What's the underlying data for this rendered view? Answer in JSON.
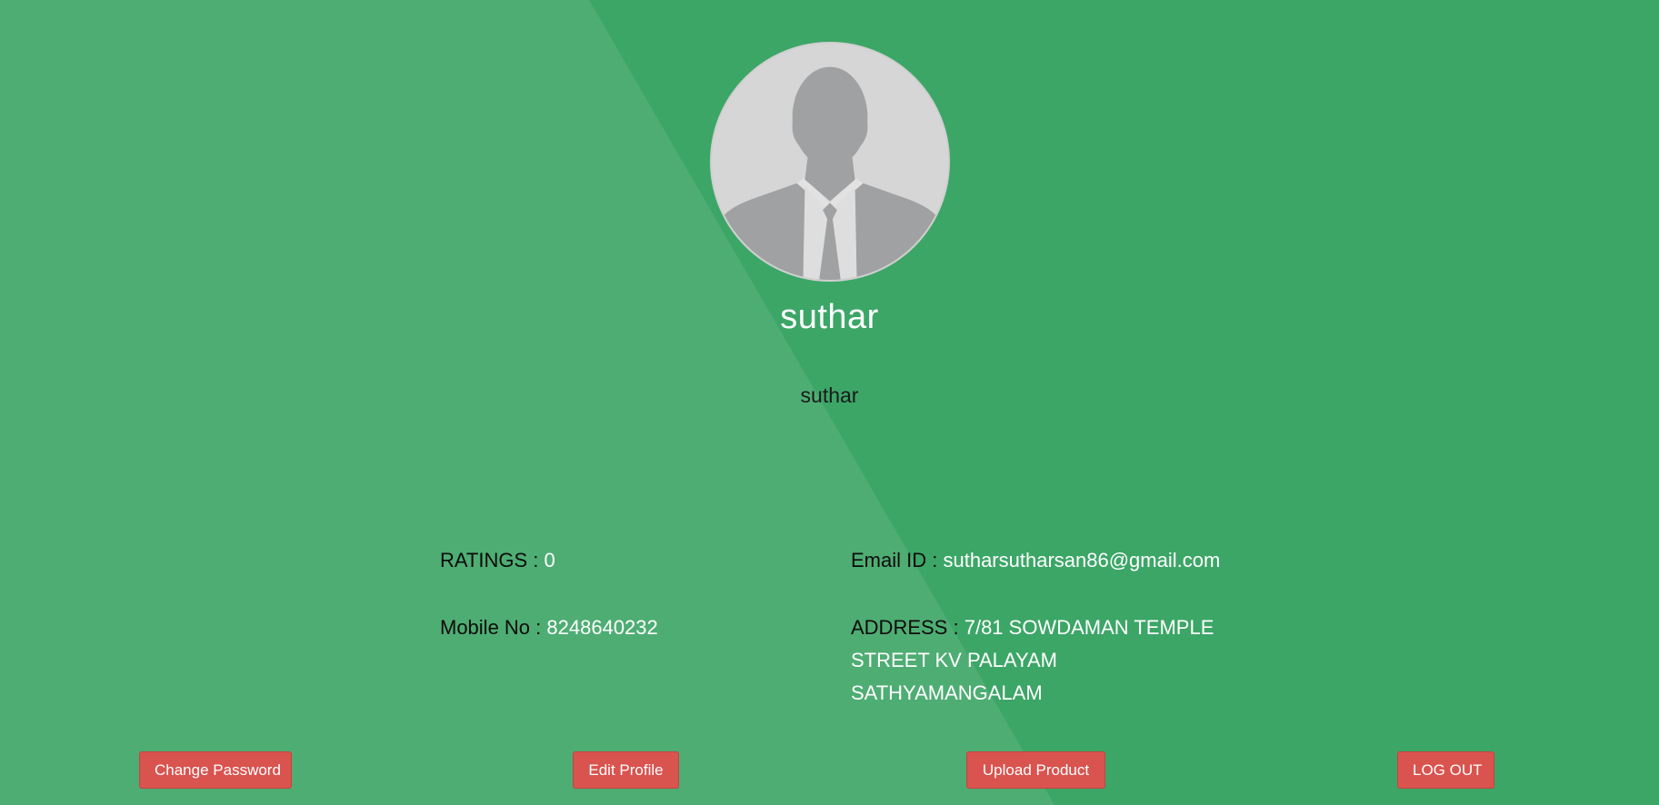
{
  "profile": {
    "name": "suthar",
    "subtitle": "suthar"
  },
  "info": {
    "ratings_label": "RATINGS :",
    "ratings_value": "0",
    "mobile_label": "Mobile No :",
    "mobile_value": "8248640232",
    "email_label": "Email ID :",
    "email_value": "sutharsutharsan86@gmail.com",
    "address_label": "ADDRESS :",
    "address_value": "7/81 SOWDAMAN TEMPLE STREET KV PALAYAM SATHYAMANGALAM"
  },
  "buttons": {
    "change_password": "Change Password",
    "edit_profile": "Edit Profile",
    "upload_product": "Upload Product",
    "logout": "LOG OUT"
  },
  "colors": {
    "background": "#3ca667",
    "background_wedge": "#4ead73",
    "button": "#d9534f",
    "avatar_bg": "#d6d6d6",
    "avatar_silhouette": "#a0a1a3"
  },
  "icons": {
    "avatar": "default-user-silhouette-icon"
  }
}
